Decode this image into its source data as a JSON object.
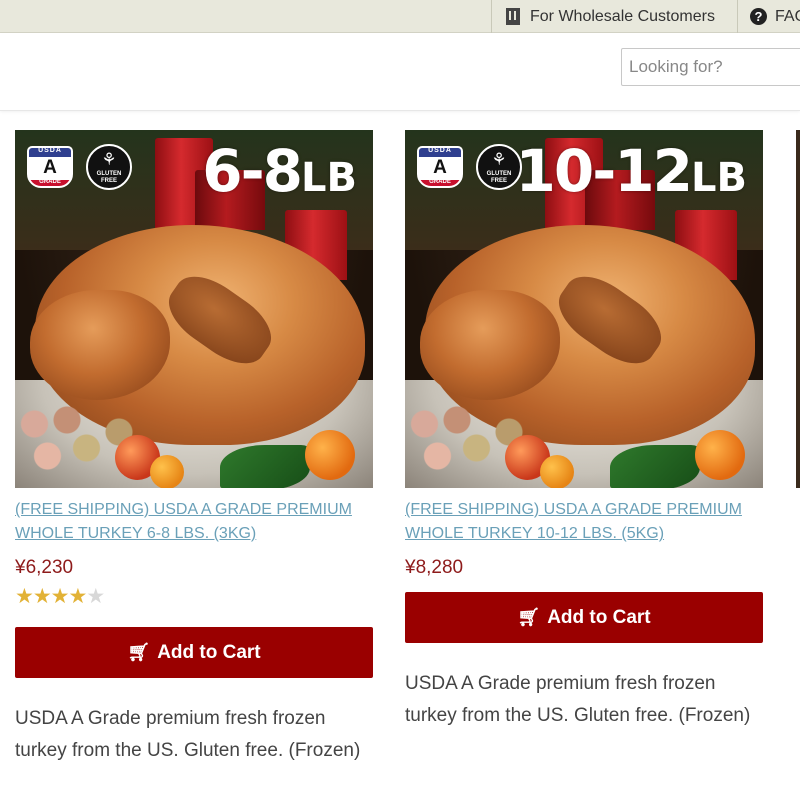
{
  "topbar": {
    "wholesale_label": "For Wholesale Customers",
    "faq_label": "FAQ"
  },
  "search": {
    "placeholder": "Looking for?"
  },
  "icons": {
    "wholesale": "building-icon",
    "faq": "question-circle-icon",
    "cart": "shopping-cart-icon",
    "usda_badge": "usda-grade-a-badge",
    "gluten_free_badge": "gluten-free-badge"
  },
  "colors": {
    "price": "#8e1b1b",
    "cart_button": "#9a0000",
    "title_link": "#6aa0b8",
    "star": "#e2b236"
  },
  "products": [
    {
      "size_number": "6-8",
      "size_unit": "LB",
      "usda_top": "USDA",
      "usda_grade": "A",
      "usda_bottom": "GRADE",
      "gf_text": "GLUTEN FREE",
      "title": "(FREE SHIPPING) USDA A GRADE PREMIUM WHOLE TURKEY 6-8 LBS. (3KG)",
      "price": "¥6,230",
      "rating": 4,
      "stars_on": "★★★★",
      "stars_off": "★",
      "cart_label": "Add to Cart",
      "description": "USDA A Grade premium fresh frozen turkey from the US. Gluten free. (Frozen)"
    },
    {
      "size_number": "10-12",
      "size_unit": "LB",
      "usda_top": "USDA",
      "usda_grade": "A",
      "usda_bottom": "GRADE",
      "gf_text": "GLUTEN FREE",
      "title": "(FREE SHIPPING) USDA A GRADE PREMIUM WHOLE TURKEY 10-12 LBS. (5KG)",
      "price": "¥8,280",
      "cart_label": "Add to Cart",
      "description": "USDA A Grade premium fresh frozen turkey from the US. Gluten free. (Frozen)"
    }
  ]
}
